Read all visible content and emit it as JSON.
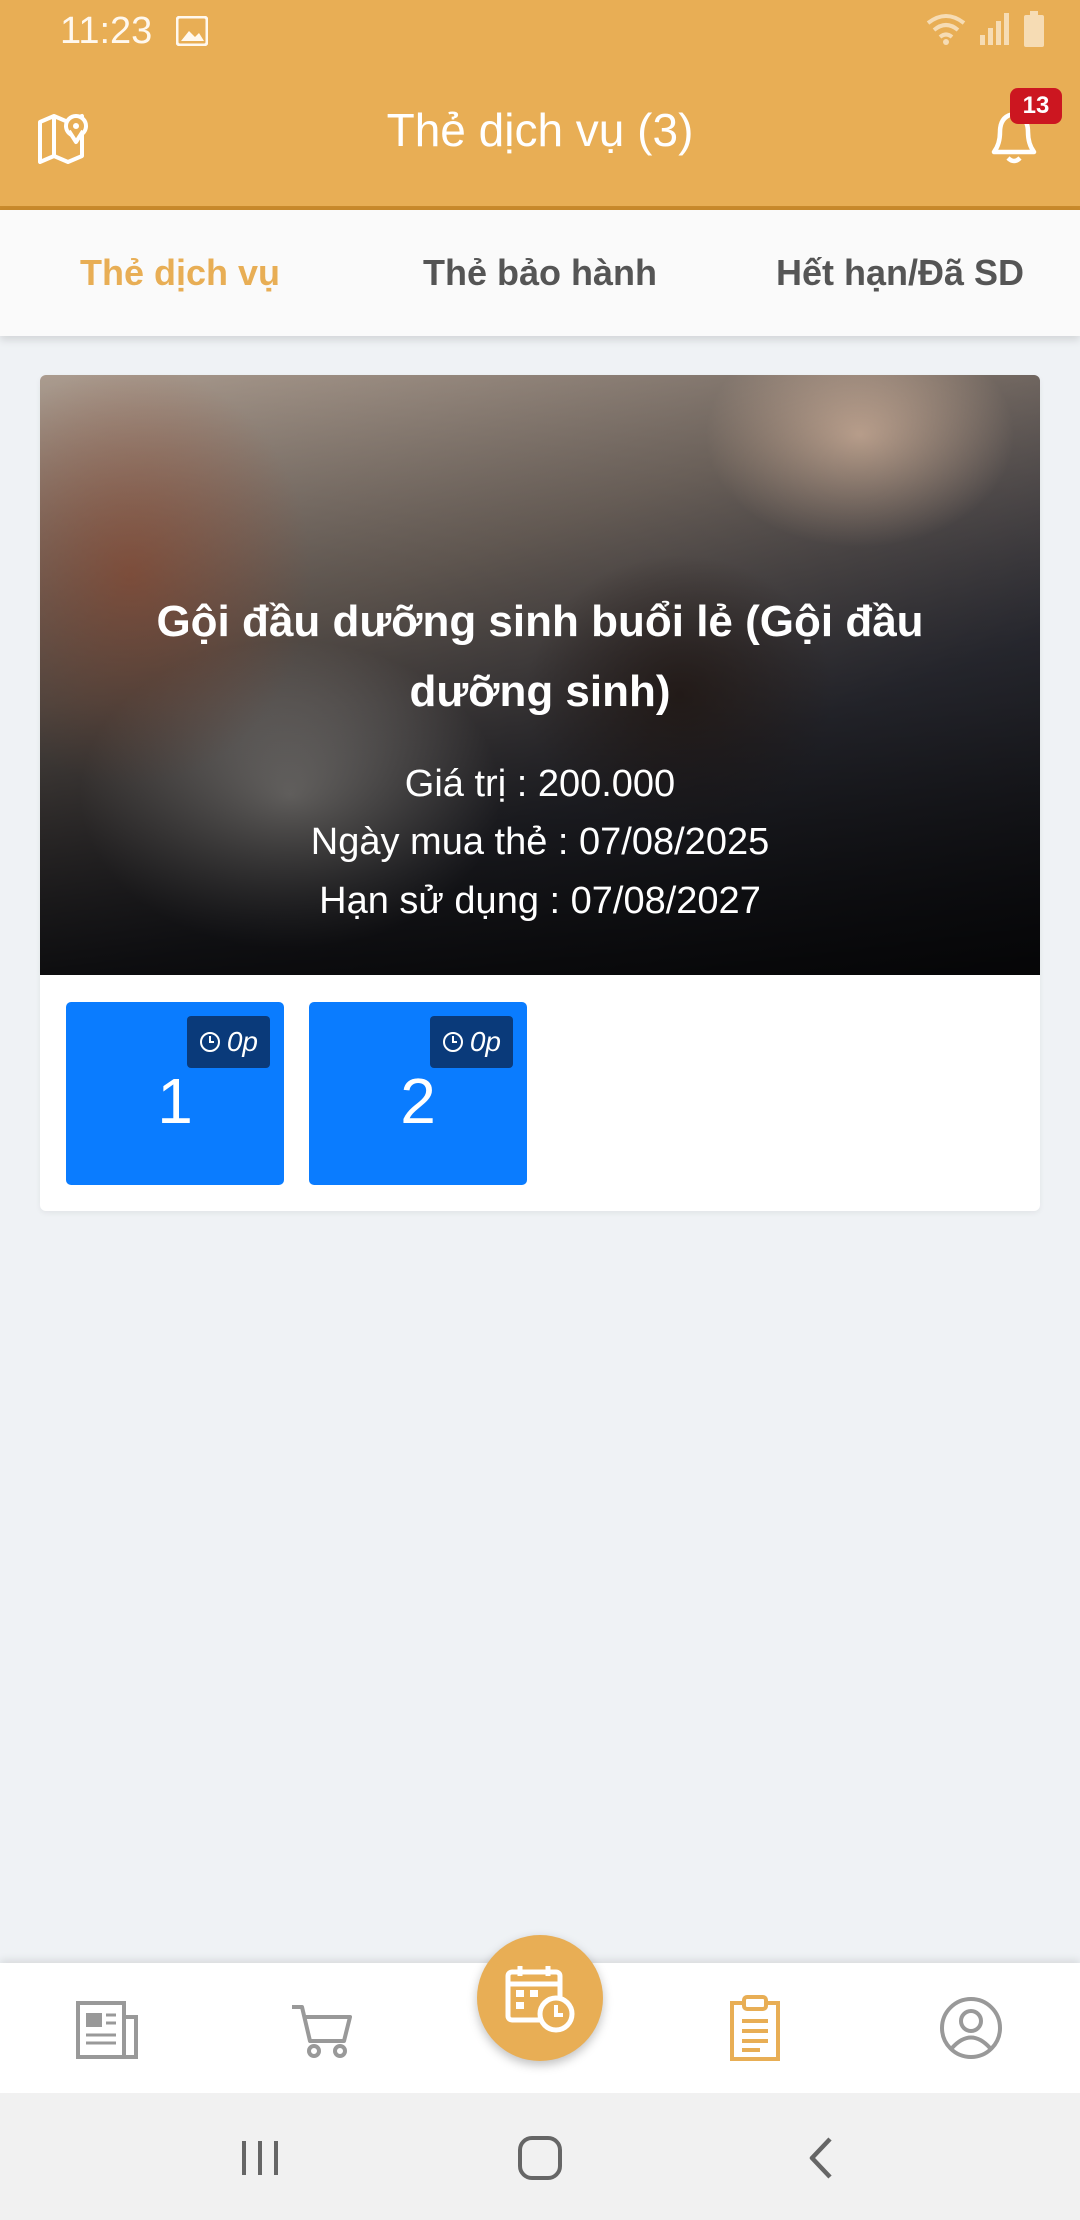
{
  "status_bar": {
    "time": "11:23"
  },
  "header": {
    "title": "Thẻ dịch vụ (3)",
    "notification_count": "13",
    "icons": [
      "map-pin-icon",
      "bell-icon"
    ]
  },
  "tabs": [
    {
      "label": "Thẻ dịch vụ",
      "active": true
    },
    {
      "label": "Thẻ bảo hành",
      "active": false
    },
    {
      "label": "Hết hạn/Đã SD",
      "active": false
    }
  ],
  "card": {
    "title": "Gội đầu dưỡng sinh buổi lẻ (Gội đầu dưỡng sinh)",
    "value_label": "Giá trị :",
    "value": "200.000",
    "purchase_label": "Ngày mua thẻ :",
    "purchase_date": "07/08/2025",
    "expiry_label": "Hạn sử dụng :",
    "expiry_date": "07/08/2027",
    "sessions": [
      {
        "number": "1",
        "time": "0p"
      },
      {
        "number": "2",
        "time": "0p"
      }
    ]
  },
  "bottom_nav": {
    "items": [
      "news-icon",
      "cart-icon",
      "calendar-clock-icon",
      "clipboard-icon",
      "profile-icon"
    ],
    "active": "clipboard-icon"
  },
  "colors": {
    "brand": "#e8ae55",
    "session_tile": "#0a7cff",
    "badge": "#cc1620"
  }
}
